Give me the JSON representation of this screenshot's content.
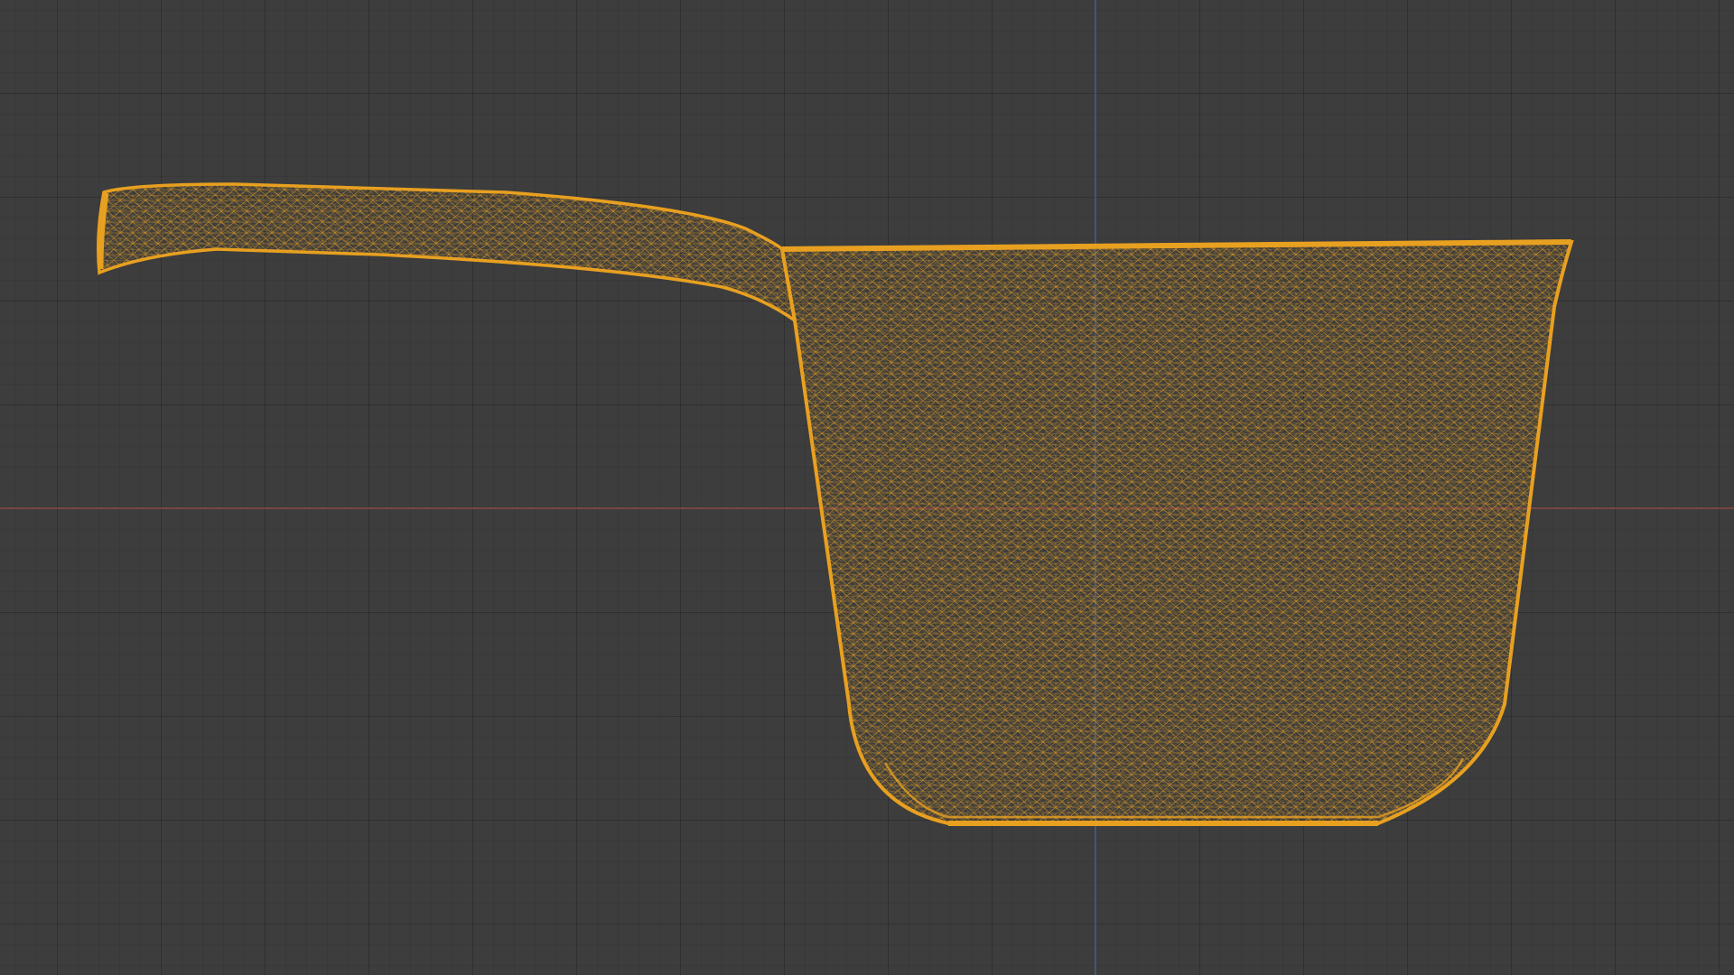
{
  "viewport": {
    "mode": "wireframe",
    "view": "front-orthographic",
    "background_color": "#3d3d3d",
    "x_axis_color": "#8a4a4a",
    "z_axis_color": "#4a5f8a",
    "wire_color": "#e8a020"
  },
  "object": {
    "name": "saucepan-mesh",
    "selected": true
  }
}
